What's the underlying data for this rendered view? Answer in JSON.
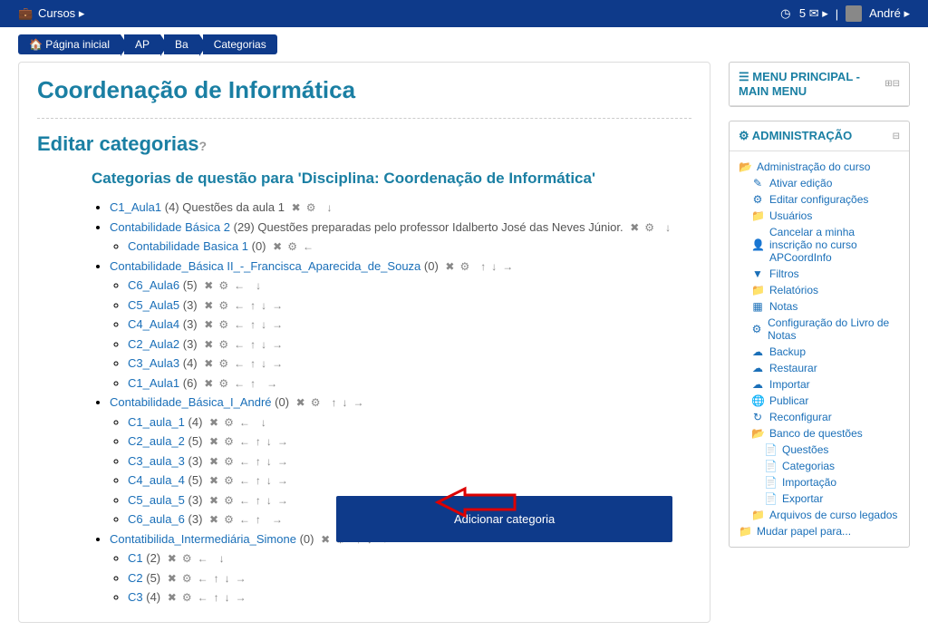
{
  "topbar": {
    "courses_label": "Cursos",
    "message_count": "5",
    "user_name": "André"
  },
  "breadcrumbs": {
    "home": "Página inicial",
    "crumb1": "AP",
    "crumb2": "Ba",
    "crumb3": "Categorias"
  },
  "page": {
    "title": "Coordenação de Informática",
    "section_title": "Editar categorias",
    "help_icon": "?",
    "subsection_title": "Categorias de questão para 'Disciplina: Coordenação de Informática'",
    "add_button": "Adicionar categoria"
  },
  "categories": [
    {
      "name": "C1_Aula1",
      "count": "(4)",
      "desc": "Questões da aula 1",
      "icons": [
        "x",
        "gear",
        "spacer",
        "down"
      ],
      "children": []
    },
    {
      "name": "Contabilidade Básica 2",
      "count": "(29)",
      "desc": "Questões preparadas pelo professor Idalberto José das Neves Júnior.",
      "icons": [
        "x",
        "gear",
        "spacer",
        "down"
      ],
      "children": [
        {
          "name": "Contabilidade Basica 1",
          "count": "(0)",
          "desc": "",
          "icons": [
            "x",
            "gear",
            "left"
          ],
          "children": []
        }
      ]
    },
    {
      "name": "Contabilidade_Básica II_-_Francisca_Aparecida_de_Souza",
      "count": "(0)",
      "desc": "",
      "icons": [
        "x",
        "gear",
        "spacer",
        "up",
        "down",
        "right"
      ],
      "children": [
        {
          "name": "C6_Aula6",
          "count": "(5)",
          "desc": "",
          "icons": [
            "x",
            "gear",
            "left",
            "spacer",
            "down"
          ],
          "children": []
        },
        {
          "name": "C5_Aula5",
          "count": "(3)",
          "desc": "",
          "icons": [
            "x",
            "gear",
            "left",
            "up",
            "down",
            "right"
          ],
          "children": []
        },
        {
          "name": "C4_Aula4",
          "count": "(3)",
          "desc": "",
          "icons": [
            "x",
            "gear",
            "left",
            "up",
            "down",
            "right"
          ],
          "children": []
        },
        {
          "name": "C2_Aula2",
          "count": "(3)",
          "desc": "",
          "icons": [
            "x",
            "gear",
            "left",
            "up",
            "down",
            "right"
          ],
          "children": []
        },
        {
          "name": "C3_Aula3",
          "count": "(4)",
          "desc": "",
          "icons": [
            "x",
            "gear",
            "left",
            "up",
            "down",
            "right"
          ],
          "children": []
        },
        {
          "name": "C1_Aula1",
          "count": "(6)",
          "desc": "",
          "icons": [
            "x",
            "gear",
            "left",
            "up",
            "spacer",
            "right"
          ],
          "children": []
        }
      ]
    },
    {
      "name": "Contabilidade_Básica_I_André",
      "count": "(0)",
      "desc": "",
      "icons": [
        "x",
        "gear",
        "spacer",
        "up",
        "down",
        "right"
      ],
      "children": [
        {
          "name": "C1_aula_1",
          "count": "(4)",
          "desc": "",
          "icons": [
            "x",
            "gear",
            "left",
            "spacer",
            "down"
          ],
          "children": []
        },
        {
          "name": "C2_aula_2",
          "count": "(5)",
          "desc": "",
          "icons": [
            "x",
            "gear",
            "left",
            "up",
            "down",
            "right"
          ],
          "children": []
        },
        {
          "name": "C3_aula_3",
          "count": "(3)",
          "desc": "",
          "icons": [
            "x",
            "gear",
            "left",
            "up",
            "down",
            "right"
          ],
          "children": []
        },
        {
          "name": "C4_aula_4",
          "count": "(5)",
          "desc": "",
          "icons": [
            "x",
            "gear",
            "left",
            "up",
            "down",
            "right"
          ],
          "children": []
        },
        {
          "name": "C5_aula_5",
          "count": "(3)",
          "desc": "",
          "icons": [
            "x",
            "gear",
            "left",
            "up",
            "down",
            "right"
          ],
          "children": []
        },
        {
          "name": "C6_aula_6",
          "count": "(3)",
          "desc": "",
          "icons": [
            "x",
            "gear",
            "left",
            "up",
            "spacer",
            "right"
          ],
          "children": []
        }
      ]
    },
    {
      "name": "Contatibilida_Intermediária_Simone",
      "count": "(0)",
      "desc": "",
      "icons": [
        "x",
        "gear",
        "spacer",
        "up",
        "down",
        "right"
      ],
      "children": [
        {
          "name": "C1",
          "count": "(2)",
          "desc": "",
          "icons": [
            "x",
            "gear",
            "left",
            "spacer",
            "down"
          ],
          "children": []
        },
        {
          "name": "C2",
          "count": "(5)",
          "desc": "",
          "icons": [
            "x",
            "gear",
            "left",
            "up",
            "down",
            "right"
          ],
          "children": []
        },
        {
          "name": "C3",
          "count": "(4)",
          "desc": "",
          "icons": [
            "x",
            "gear",
            "left",
            "up",
            "down",
            "right"
          ],
          "children": []
        }
      ]
    }
  ],
  "blocks": {
    "mainmenu": {
      "title": "MENU PRINCIPAL - MAIN MENU"
    },
    "admin": {
      "title": "ADMINISTRAÇÃO",
      "items": [
        {
          "icon": "folder-open",
          "label": "Administração do curso",
          "level": 1
        },
        {
          "icon": "pencil",
          "label": "Ativar edição",
          "level": 2
        },
        {
          "icon": "gear",
          "label": "Editar configurações",
          "level": 2
        },
        {
          "icon": "folder",
          "label": "Usuários",
          "level": 2
        },
        {
          "icon": "user",
          "label": "Cancelar a minha inscrição no curso APCoordInfo",
          "level": 2
        },
        {
          "icon": "filter",
          "label": "Filtros",
          "level": 2
        },
        {
          "icon": "folder",
          "label": "Relatórios",
          "level": 2
        },
        {
          "icon": "grid",
          "label": "Notas",
          "level": 2
        },
        {
          "icon": "gear",
          "label": "Configuração do Livro de Notas",
          "level": 2
        },
        {
          "icon": "cloud-down",
          "label": "Backup",
          "level": 2
        },
        {
          "icon": "cloud-up",
          "label": "Restaurar",
          "level": 2
        },
        {
          "icon": "cloud-up",
          "label": "Importar",
          "level": 2
        },
        {
          "icon": "globe",
          "label": "Publicar",
          "level": 2
        },
        {
          "icon": "refresh",
          "label": "Reconfigurar",
          "level": 2
        },
        {
          "icon": "folder-open",
          "label": "Banco de questões",
          "level": 2
        },
        {
          "icon": "file",
          "label": "Questões",
          "level": 3
        },
        {
          "icon": "file",
          "label": "Categorias",
          "level": 3
        },
        {
          "icon": "file",
          "label": "Importação",
          "level": 3
        },
        {
          "icon": "file",
          "label": "Exportar",
          "level": 3
        },
        {
          "icon": "folder",
          "label": "Arquivos de curso legados",
          "level": 2
        },
        {
          "icon": "folder",
          "label": "Mudar papel para...",
          "level": 1
        }
      ]
    }
  },
  "icons": {
    "x": "✖",
    "gear": "⚙",
    "down": "↓",
    "up": "↑",
    "left": "←",
    "right": "→",
    "spacer": " ",
    "folder-open": "📂",
    "folder": "📁",
    "pencil": "✎",
    "user": "👤",
    "filter": "▼",
    "grid": "▦",
    "cloud-down": "☁",
    "cloud-up": "☁",
    "globe": "🌐",
    "refresh": "↻",
    "file": "📄",
    "briefcase": "💼",
    "clock": "◷",
    "envelope": "✉",
    "bar": "|",
    "caret": "▸",
    "caret-down": "▾",
    "list": "☰",
    "plus-box": "⊞",
    "minus-box": "⊟",
    "dash-box": "⊟"
  }
}
